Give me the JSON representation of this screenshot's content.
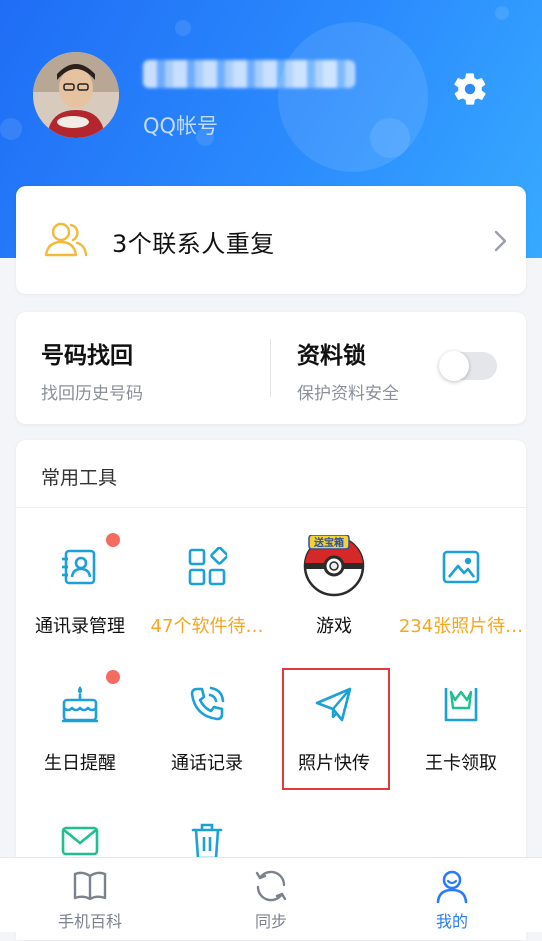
{
  "colors": {
    "brand_blue": "#2a7cf6",
    "orange_text": "#f5a623",
    "red_dot": "#f56b5f",
    "highlight_border": "#e03a3a",
    "icon_teal": "#1ba0d8",
    "duplicate_icon": "#f5b93a"
  },
  "profile": {
    "username": "",
    "account_label": "QQ帐号",
    "settings_icon": "gear-icon"
  },
  "duplicate_contacts": {
    "text": "3个联系人重复",
    "icon": "contacts-icon"
  },
  "features": {
    "recover": {
      "title": "号码找回",
      "subtitle": "找回历史号码"
    },
    "lock": {
      "title": "资料锁",
      "subtitle": "保护资料安全",
      "enabled": false
    }
  },
  "tools": {
    "title": "常用工具",
    "items": [
      {
        "label": "通讯录管理",
        "icon": "address-book-icon",
        "badge": true,
        "orange": false
      },
      {
        "label": "47个软件待…",
        "icon": "apps-grid-icon",
        "badge": false,
        "orange": true
      },
      {
        "label": "游戏",
        "icon": "pokeball-game-icon",
        "badge": false,
        "orange": false
      },
      {
        "label": "234张照片待…",
        "icon": "photo-icon",
        "badge": false,
        "orange": true
      },
      {
        "label": "生日提醒",
        "icon": "birthday-cake-icon",
        "badge": true,
        "orange": false
      },
      {
        "label": "通话记录",
        "icon": "phone-call-icon",
        "badge": false,
        "orange": false
      },
      {
        "label": "照片快传",
        "icon": "paper-plane-icon",
        "badge": false,
        "orange": false,
        "highlighted": true
      },
      {
        "label": "王卡领取",
        "icon": "crown-card-icon",
        "badge": false,
        "orange": false
      },
      {
        "label": "",
        "icon": "mail-icon",
        "badge": false,
        "orange": false
      },
      {
        "label": "",
        "icon": "trash-icon",
        "badge": false,
        "orange": false
      }
    ],
    "game_badge_text": "送宝箱"
  },
  "tabbar": {
    "items": [
      {
        "label": "手机百科",
        "icon": "book-icon",
        "active": false
      },
      {
        "label": "同步",
        "icon": "sync-icon",
        "active": false
      },
      {
        "label": "我的",
        "icon": "profile-icon",
        "active": true
      }
    ]
  }
}
